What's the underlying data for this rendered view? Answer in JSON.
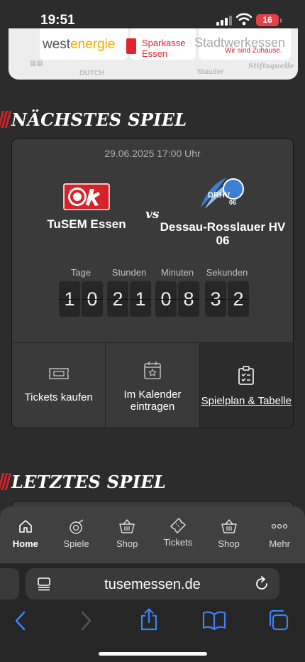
{
  "status_bar": {
    "time": "19:51",
    "battery": "16"
  },
  "sponsors": {
    "westenergie_a": "west",
    "westenergie_b": "energie",
    "sparkasse": [
      "Sparkasse",
      "Essen"
    ],
    "stadtwerke": "Stadtwerkessen",
    "stadtwerke_tag": "Wir sind Zuhause.",
    "faded": [
      "DUTCH",
      "Stauder",
      "Stiftsquelle"
    ]
  },
  "next_match": {
    "heading": "NÄCHSTES SPIEL",
    "date": "29.06.2025 17:00 Uhr",
    "home_team": "TuSEM Essen",
    "vs": "vs",
    "away_team": "Dessau-Rosslauer HV 06",
    "away_logo_text": "DRHV",
    "away_logo_num": "06",
    "countdown": {
      "days": {
        "label": "Tage",
        "digits": [
          "1",
          "0"
        ]
      },
      "hours": {
        "label": "Stunden",
        "digits": [
          "2",
          "1"
        ]
      },
      "minutes": {
        "label": "Minuten",
        "digits": [
          "0",
          "8"
        ]
      },
      "seconds": {
        "label": "Sekunden",
        "digits": [
          "3",
          "2"
        ]
      }
    },
    "actions": {
      "tickets": "Tickets kaufen",
      "calendar": [
        "Im Kalender",
        "eintragen"
      ],
      "schedule": "Spielplan & Tabelle"
    }
  },
  "last_match": {
    "heading": "LETZTES SPIEL"
  },
  "app_nav": [
    {
      "label": "Home",
      "icon": "home-icon"
    },
    {
      "label": "Spiele",
      "icon": "handball-icon"
    },
    {
      "label": "Shop",
      "icon": "basket-icon"
    },
    {
      "label": "Tickets",
      "icon": "ticket-icon"
    },
    {
      "label": "Shop",
      "icon": "basket-icon"
    },
    {
      "label": "Mehr",
      "icon": "more-icon"
    }
  ],
  "safari": {
    "url": "tusemessen.de"
  },
  "colors": {
    "brand_red": "#d62229",
    "card_bg": "#3a3a3a",
    "page_bg": "#2c2c2c",
    "drhv_blue": "#3b7fd0"
  }
}
